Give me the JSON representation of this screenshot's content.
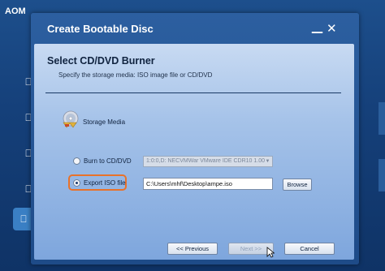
{
  "app": {
    "title": "AOM",
    "sidebar_icon_glyph": "⎕"
  },
  "dialog": {
    "title": "Create Bootable Disc",
    "minimize_glyph": "—",
    "close_glyph": "✕",
    "section_title": "Select CD/DVD Burner",
    "section_subtitle": "Specify the storage media: ISO image file or CD/DVD",
    "storage_label": "Storage Media",
    "burn_option": {
      "label": "Burn to CD/DVD",
      "selected": false,
      "device_value": "1:0:0,D: NECVMWar VMware IDE CDR10 1.00",
      "arrow_glyph": "▼"
    },
    "export_option": {
      "label": "Export ISO file",
      "selected": true,
      "path_value": "C:\\Users\\mhf\\Desktop\\ampe.iso",
      "browse_label": "Browse"
    },
    "buttons": {
      "previous": "<< Previous",
      "next": "Next >>",
      "cancel": "Cancel"
    }
  },
  "colors": {
    "highlight": "#e8722a",
    "accent": "#1e4b88"
  }
}
